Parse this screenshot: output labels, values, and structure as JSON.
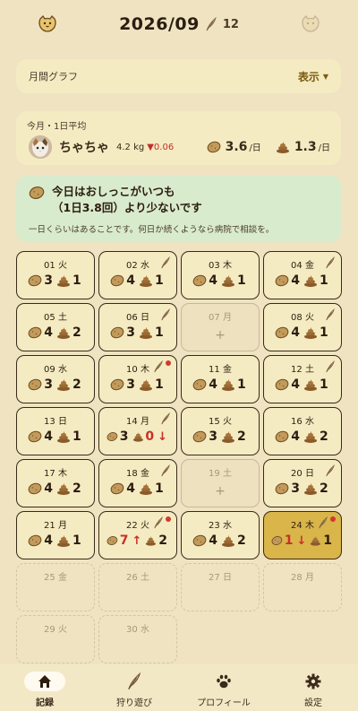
{
  "header": {
    "title": "2026/09",
    "feather_count": "12"
  },
  "graph": {
    "title": "月間グラフ",
    "toggle_label": "表示"
  },
  "average": {
    "label": "今月・1日平均",
    "cat_name": "ちゃちゃ",
    "weight": "4.2 kg",
    "weight_diff": "▼0.06",
    "pee_avg": "3.6",
    "pee_unit": "/日",
    "poop_avg": "1.3",
    "poop_unit": "/日"
  },
  "alert": {
    "line1": "今日はおしっこがいつも",
    "line2": "（1日3.8回）より少ないです",
    "body": "一日くらいはあることです。何日か続くようなら病院で相談を。"
  },
  "days": [
    {
      "label": "01 火",
      "pee": "3",
      "poop": "1",
      "state": "normal",
      "feather": false,
      "dot": false
    },
    {
      "label": "02 水",
      "pee": "4",
      "poop": "1",
      "state": "normal",
      "feather": true,
      "dot": false
    },
    {
      "label": "03 木",
      "pee": "4",
      "poop": "1",
      "state": "normal",
      "feather": false,
      "dot": false
    },
    {
      "label": "04 金",
      "pee": "4",
      "poop": "1",
      "state": "normal",
      "feather": true,
      "dot": false
    },
    {
      "label": "05 土",
      "pee": "4",
      "poop": "2",
      "state": "normal",
      "feather": false,
      "dot": false
    },
    {
      "label": "06 日",
      "pee": "3",
      "poop": "1",
      "state": "normal",
      "feather": true,
      "dot": false
    },
    {
      "label": "07 月",
      "plus": "+",
      "state": "empty",
      "feather": false,
      "dot": false
    },
    {
      "label": "08 火",
      "pee": "4",
      "poop": "1",
      "state": "normal",
      "feather": true,
      "dot": false
    },
    {
      "label": "09 水",
      "pee": "3",
      "poop": "2",
      "state": "normal",
      "feather": false,
      "dot": false
    },
    {
      "label": "10 木",
      "pee": "3",
      "poop": "1",
      "state": "normal",
      "feather": true,
      "dot": true
    },
    {
      "label": "11 金",
      "pee": "4",
      "poop": "1",
      "state": "normal",
      "feather": false,
      "dot": false
    },
    {
      "label": "12 土",
      "pee": "4",
      "poop": "1",
      "state": "normal",
      "feather": true,
      "dot": false
    },
    {
      "label": "13 日",
      "pee": "4",
      "poop": "1",
      "state": "normal",
      "feather": false,
      "dot": false
    },
    {
      "label": "14 月",
      "pee": "3",
      "poop": "0",
      "poop_arrow": "↓",
      "state": "normal",
      "feather": true,
      "dot": false
    },
    {
      "label": "15 火",
      "pee": "3",
      "poop": "2",
      "state": "normal",
      "feather": false,
      "dot": false
    },
    {
      "label": "16 水",
      "pee": "4",
      "poop": "2",
      "state": "normal",
      "feather": false,
      "dot": false
    },
    {
      "label": "17 木",
      "pee": "4",
      "poop": "2",
      "state": "normal",
      "feather": false,
      "dot": false
    },
    {
      "label": "18 金",
      "pee": "4",
      "poop": "1",
      "state": "normal",
      "feather": true,
      "dot": false
    },
    {
      "label": "19 土",
      "plus": "+",
      "state": "empty",
      "feather": false,
      "dot": false
    },
    {
      "label": "20 日",
      "pee": "3",
      "poop": "2",
      "state": "normal",
      "feather": true,
      "dot": false
    },
    {
      "label": "21 月",
      "pee": "4",
      "poop": "1",
      "state": "normal",
      "feather": false,
      "dot": false
    },
    {
      "label": "22 火",
      "pee": "7",
      "pee_arrow": "↑",
      "poop": "2",
      "state": "normal",
      "feather": true,
      "dot": true
    },
    {
      "label": "23 水",
      "pee": "4",
      "poop": "2",
      "state": "normal",
      "feather": false,
      "dot": false
    },
    {
      "label": "24 木",
      "pee": "1",
      "pee_arrow": "↓",
      "poop": "1",
      "state": "selected",
      "feather": true,
      "dot": true
    },
    {
      "label": "25 金",
      "state": "future",
      "feather": false,
      "dot": false
    },
    {
      "label": "26 土",
      "state": "future",
      "feather": false,
      "dot": false
    },
    {
      "label": "27 日",
      "state": "future",
      "feather": false,
      "dot": false
    },
    {
      "label": "28 月",
      "state": "future",
      "feather": false,
      "dot": false
    },
    {
      "label": "29 火",
      "state": "future",
      "feather": false,
      "dot": false
    },
    {
      "label": "30 水",
      "state": "future",
      "feather": false,
      "dot": false
    }
  ],
  "nav": [
    {
      "label": "記録",
      "icon": "home-icon",
      "active": true
    },
    {
      "label": "狩り遊び",
      "icon": "feather-icon",
      "active": false
    },
    {
      "label": "プロフィール",
      "icon": "paw-icon",
      "active": false
    },
    {
      "label": "設定",
      "icon": "gear-icon",
      "active": false
    }
  ],
  "colors": {
    "background": "#efe3c2",
    "card": "#f5ebc2",
    "alert": "#d9ebcd",
    "selected_day": "#d9b54a",
    "warning_red": "#c8302a"
  }
}
